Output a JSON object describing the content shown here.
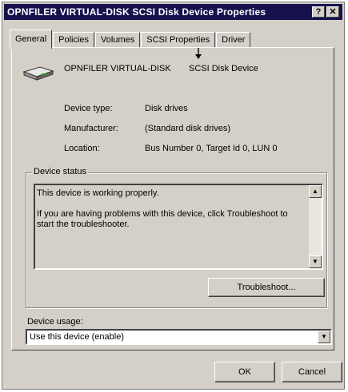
{
  "window": {
    "title": "OPNFILER VIRTUAL-DISK    SCSI Disk Device Properties",
    "help_label": "?",
    "close_label": "✕"
  },
  "tabs": [
    {
      "label": "General",
      "active": true
    },
    {
      "label": "Policies"
    },
    {
      "label": "Volumes"
    },
    {
      "label": "SCSI Properties"
    },
    {
      "label": "Driver"
    }
  ],
  "device": {
    "name": "OPNFILER VIRTUAL-DISK",
    "description": "SCSI Disk Device",
    "icon": "disk-drive-icon"
  },
  "properties": [
    {
      "label": "Device type:",
      "value": "Disk drives"
    },
    {
      "label": "Manufacturer:",
      "value": "(Standard disk drives)"
    },
    {
      "label": "Location:",
      "value": "Bus Number 0, Target Id 0, LUN 0"
    }
  ],
  "device_status": {
    "legend": "Device status",
    "line1": "This device is working properly.",
    "line2": "If you are having problems with this device, click Troubleshoot to start the troubleshooter.",
    "troubleshoot_label": "Troubleshoot..."
  },
  "device_usage": {
    "label": "Device usage:",
    "selected": "Use this device (enable)"
  },
  "footer": {
    "ok_label": "OK",
    "cancel_label": "Cancel"
  }
}
